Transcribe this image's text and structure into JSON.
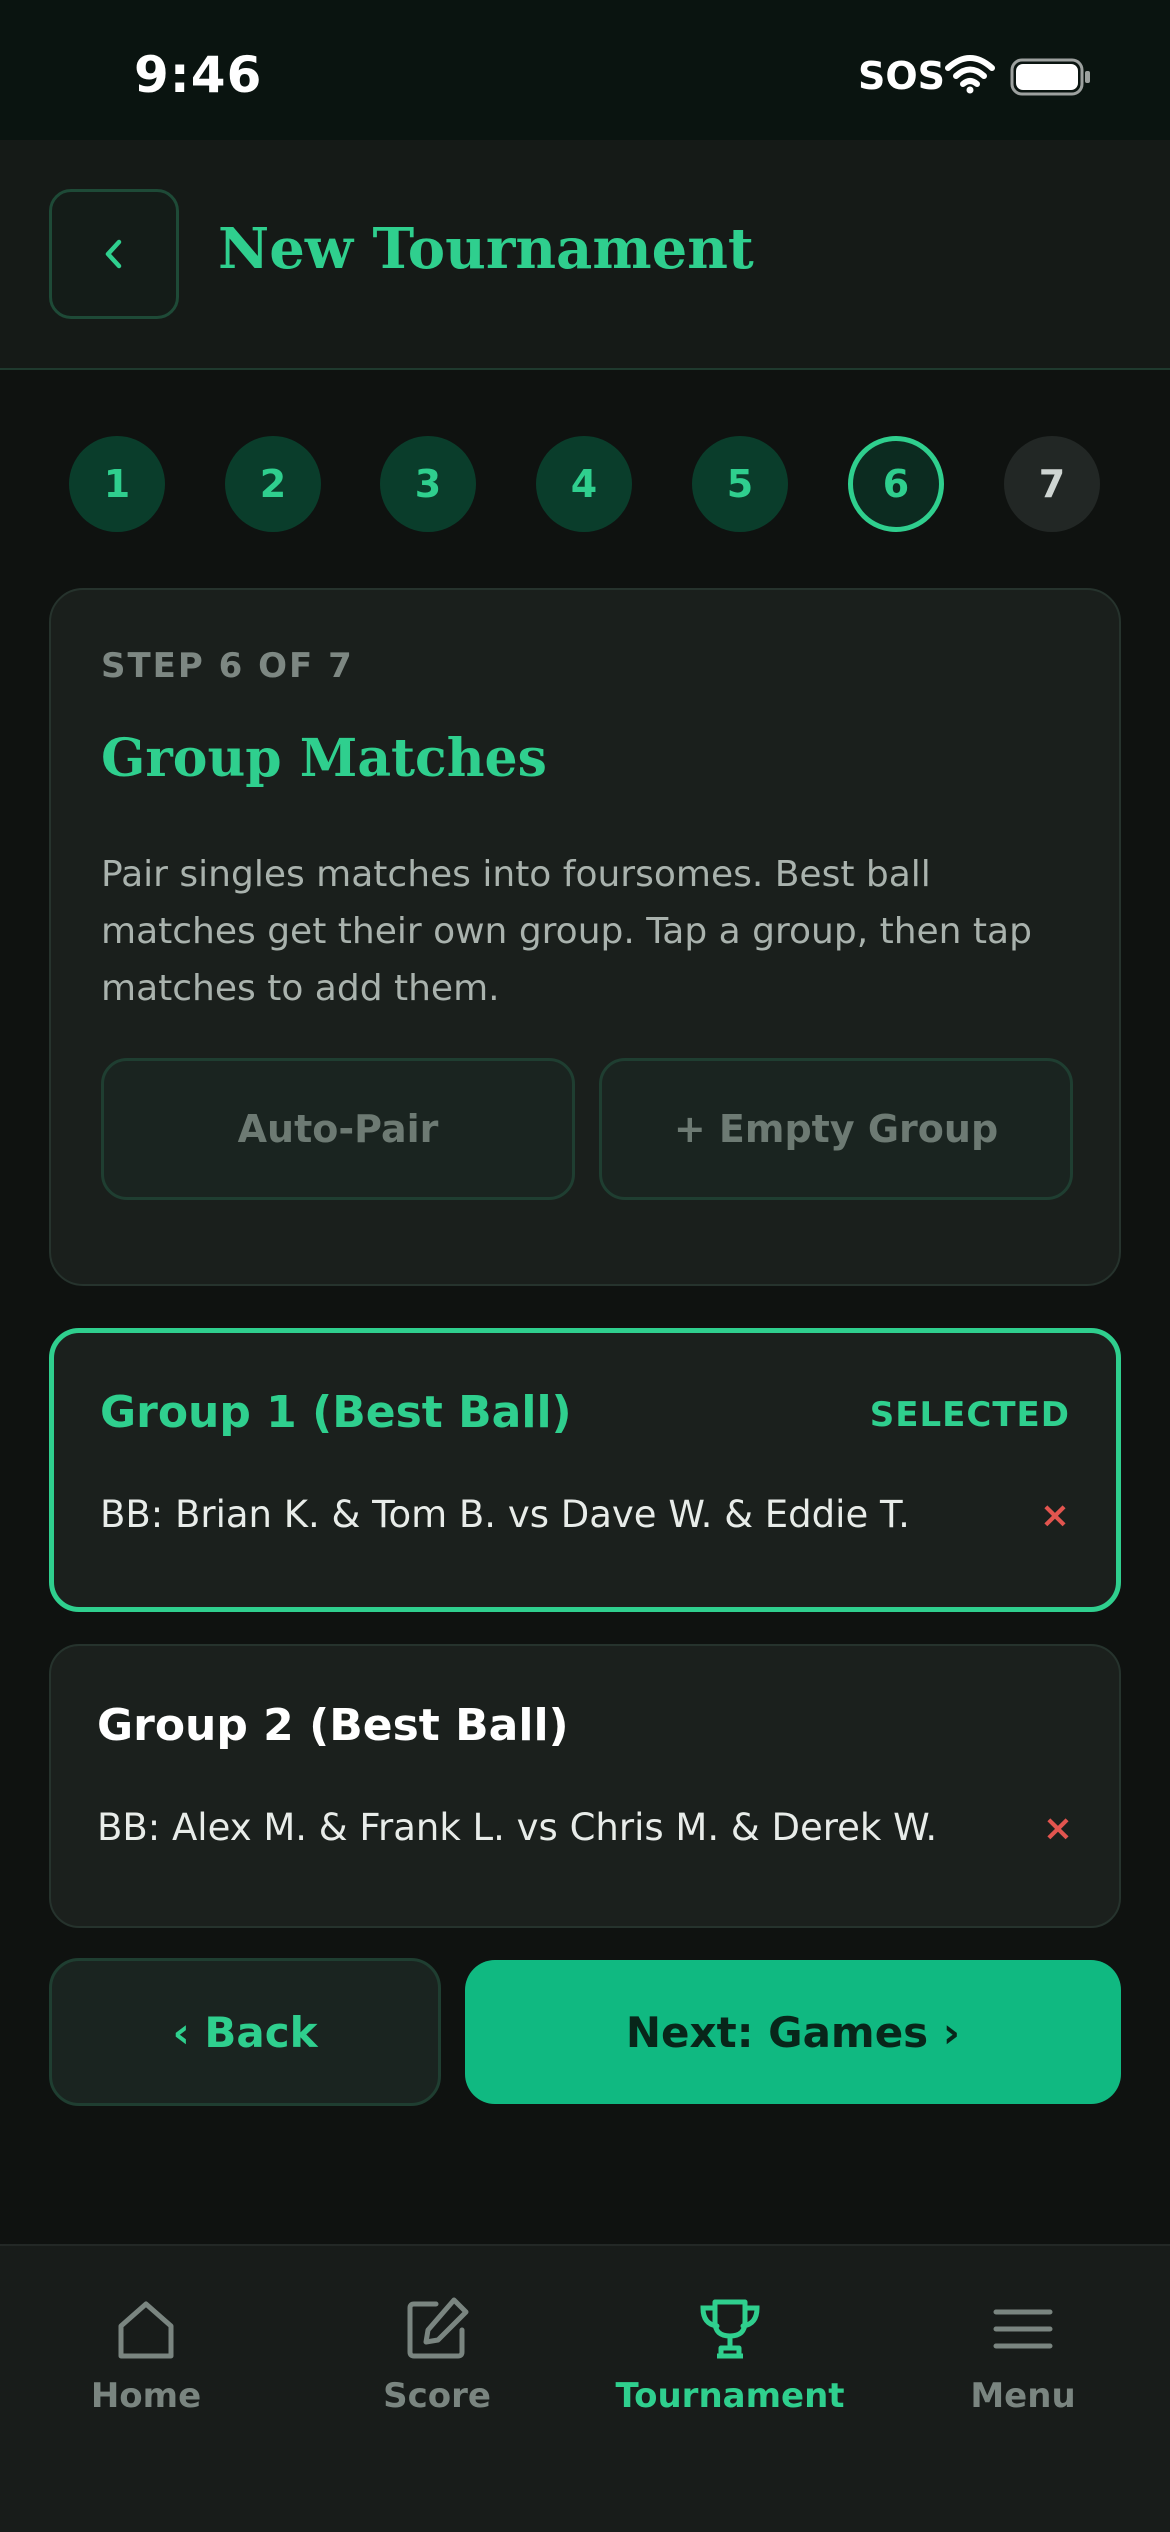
{
  "status_bar": {
    "time": "9:46",
    "sos": "SOS"
  },
  "header": {
    "title": "New Tournament"
  },
  "stepper": {
    "steps": [
      {
        "label": "1",
        "state": "done"
      },
      {
        "label": "2",
        "state": "done"
      },
      {
        "label": "3",
        "state": "done"
      },
      {
        "label": "4",
        "state": "done"
      },
      {
        "label": "5",
        "state": "done"
      },
      {
        "label": "6",
        "state": "current"
      },
      {
        "label": "7",
        "state": "todo"
      }
    ]
  },
  "info": {
    "step_label": "STEP 6 OF 7",
    "title": "Group Matches",
    "description": "Pair singles matches into foursomes. Best ball matches get their own group. Tap a group, then tap matches to add them.",
    "auto_pair_label": "Auto-Pair",
    "empty_group_label": "+ Empty Group"
  },
  "groups": [
    {
      "title": "Group 1 (Best Ball)",
      "badge": "SELECTED",
      "match": "BB: Brian K. & Tom B. vs Dave W. & Eddie T.",
      "remove": "×"
    },
    {
      "title": "Group 2 (Best Ball)",
      "match": "BB: Alex M. & Frank L. vs Chris M. & Derek W.",
      "remove": "×"
    }
  ],
  "nav": {
    "back_label": "‹ Back",
    "next_label": "Next: Games ›"
  },
  "tabs": [
    {
      "label": "Home",
      "icon": "home-icon"
    },
    {
      "label": "Score",
      "icon": "edit-icon"
    },
    {
      "label": "Tournament",
      "icon": "trophy-icon",
      "active": true
    },
    {
      "label": "Menu",
      "icon": "menu-icon"
    }
  ],
  "colors": {
    "accent": "#2fcf8e",
    "primary_button": "#10b981",
    "danger": "#e2554f",
    "background": "#0f1210"
  }
}
